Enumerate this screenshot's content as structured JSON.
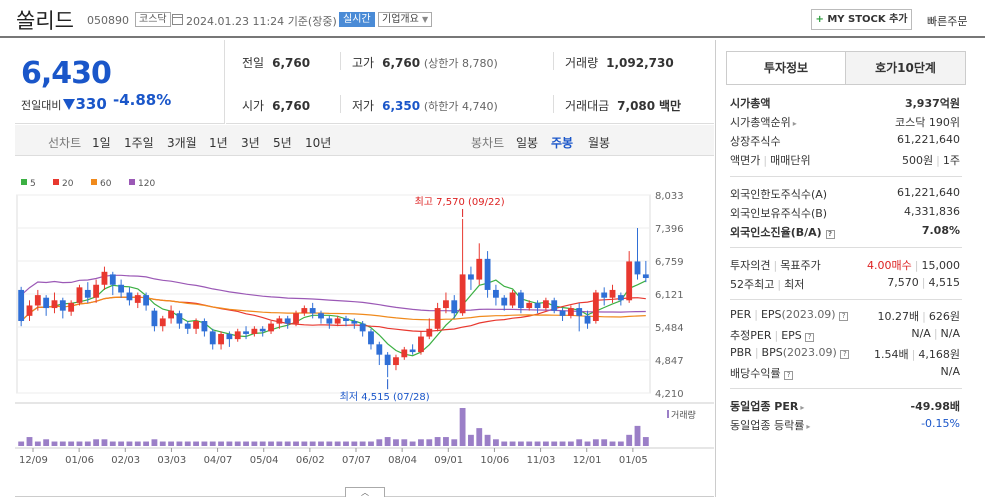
{
  "header": {
    "name": "쏠리드",
    "code": "050890",
    "market": "코스닥",
    "datetime": "2024.01.23 11:24",
    "basis": "기준(장중)",
    "realtime": "실시간",
    "company_info": "기업개요",
    "my_stock": "MY STOCK 추가",
    "quick_order": "빠른주문"
  },
  "quote": {
    "price": "6,430",
    "change_label": "전일대비",
    "change": "330",
    "change_pct": "-4.88%"
  },
  "stats": {
    "prev": {
      "label": "전일",
      "value": "6,760"
    },
    "high": {
      "label": "고가",
      "value": "6,760",
      "sub": "(상한가 8,780)"
    },
    "volume": {
      "label": "거래량",
      "value": "1,092,730"
    },
    "open": {
      "label": "시가",
      "value": "6,760"
    },
    "low": {
      "label": "저가",
      "value": "6,350",
      "sub": "(하한가 4,740)"
    },
    "amount": {
      "label": "거래대금",
      "value": "7,080",
      "unit": "백만"
    }
  },
  "toolbar": {
    "line_label": "선차트",
    "line_periods": [
      "1일",
      "1주일",
      "3개월",
      "1년",
      "3년",
      "5년",
      "10년"
    ],
    "candle_label": "봉차트",
    "candle_periods": [
      "일봉",
      "주봉",
      "월봉"
    ],
    "candle_active": "주봉"
  },
  "right_panel": {
    "tab_invest": "투자정보",
    "tab_order": "호가10단계",
    "rows": {
      "mcap": {
        "k": "시가총액",
        "v": "3,937억원"
      },
      "mcap_rank": {
        "k": "시가총액순위",
        "v": "코스닥 190위"
      },
      "shares": {
        "k": "상장주식수",
        "v": "61,221,640"
      },
      "face": {
        "k": "액면가",
        "k2": "매매단위",
        "v": "500원",
        "v2": "1주"
      },
      "foreign_limit": {
        "k": "외국인한도주식수(A)",
        "v": "61,221,640"
      },
      "foreign_hold": {
        "k": "외국인보유주식수(B)",
        "v": "4,331,836"
      },
      "foreign_rate": {
        "k": "외국인소진율(B/A)",
        "v": "7.08%"
      },
      "opinion": {
        "k": "투자의견",
        "k2": "목표주가",
        "v": "4.00매수",
        "v2": "15,000"
      },
      "week52": {
        "k": "52주최고",
        "k2": "최저",
        "v": "7,570",
        "v2": "4,515"
      },
      "per": {
        "k": "PER",
        "k2": "EPS",
        "k3": "(2023.09)",
        "v": "10.27배",
        "v2": "626원"
      },
      "eper": {
        "k": "추정PER",
        "k2": "EPS",
        "v": "N/A",
        "v2": "N/A"
      },
      "pbr": {
        "k": "PBR",
        "k2": "BPS",
        "k3": "(2023.09)",
        "v": "1.54배",
        "v2": "4,168원"
      },
      "div": {
        "k": "배당수익률",
        "v": "N/A"
      },
      "ind_per": {
        "k": "동일업종 PER",
        "v": "-49.98배"
      },
      "ind_rate": {
        "k": "동일업종 등락률",
        "v": "-0.15%"
      }
    }
  },
  "chart_data": {
    "type": "candlestick",
    "legend": [
      {
        "name": "5",
        "color": "#3cb043"
      },
      {
        "name": "20",
        "color": "#e8382f"
      },
      {
        "name": "60",
        "color": "#f08a1c"
      },
      {
        "name": "120",
        "color": "#9b59b6"
      }
    ],
    "y_ticks": [
      "8,033",
      "7,396",
      "6,759",
      "6,121",
      "5,484",
      "4,847",
      "4,210"
    ],
    "y_range": [
      4210,
      8033
    ],
    "x_ticks": [
      "12/09",
      "01/06",
      "02/03",
      "03/03",
      "04/07",
      "05/04",
      "06/02",
      "07/07",
      "08/04",
      "09/01",
      "10/06",
      "11/03",
      "12/01",
      "01/05"
    ],
    "annotations": {
      "high": "최고 7,570 (09/22)",
      "low": "최저 4,515 (07/28)"
    },
    "volume_label": "거래량",
    "up_color": "#e8382f",
    "down_color": "#2f6fd6",
    "candles": [
      [
        6200,
        5600,
        6260,
        5500
      ],
      [
        5700,
        5900,
        6000,
        5600
      ],
      [
        5900,
        6100,
        6200,
        5800
      ],
      [
        6050,
        5850,
        6100,
        5700
      ],
      [
        5850,
        6000,
        6150,
        5750
      ],
      [
        6000,
        5800,
        6050,
        5650
      ],
      [
        5780,
        5950,
        6000,
        5700
      ],
      [
        5950,
        6250,
        6300,
        5900
      ],
      [
        6200,
        6050,
        6350,
        5950
      ],
      [
        6050,
        6300,
        6400,
        5950
      ],
      [
        6300,
        6550,
        6650,
        6200
      ],
      [
        6500,
        6300,
        6550,
        6100
      ],
      [
        6300,
        6150,
        6400,
        6050
      ],
      [
        6150,
        6000,
        6250,
        5900
      ],
      [
        5950,
        6100,
        6150,
        5850
      ],
      [
        6100,
        5900,
        6150,
        5800
      ],
      [
        5800,
        5500,
        5850,
        5400
      ],
      [
        5500,
        5650,
        5700,
        5400
      ],
      [
        5650,
        5800,
        5900,
        5550
      ],
      [
        5750,
        5550,
        5800,
        5450
      ],
      [
        5550,
        5450,
        5600,
        5350
      ],
      [
        5450,
        5600,
        5650,
        5350
      ],
      [
        5600,
        5400,
        5650,
        5300
      ],
      [
        5400,
        5150,
        5450,
        5050
      ],
      [
        5150,
        5350,
        5400,
        5050
      ],
      [
        5350,
        5250,
        5400,
        5100
      ],
      [
        5250,
        5400,
        5450,
        5200
      ],
      [
        5400,
        5350,
        5500,
        5250
      ],
      [
        5350,
        5450,
        5500,
        5300
      ],
      [
        5450,
        5400,
        5500,
        5300
      ],
      [
        5400,
        5550,
        5600,
        5350
      ],
      [
        5550,
        5650,
        5700,
        5450
      ],
      [
        5650,
        5550,
        5700,
        5450
      ],
      [
        5550,
        5750,
        5800,
        5500
      ],
      [
        5750,
        5850,
        5900,
        5700
      ],
      [
        5850,
        5750,
        5950,
        5650
      ],
      [
        5750,
        5650,
        5800,
        5550
      ],
      [
        5650,
        5550,
        5700,
        5450
      ],
      [
        5550,
        5650,
        5700,
        5500
      ],
      [
        5650,
        5600,
        5700,
        5500
      ],
      [
        5600,
        5550,
        5650,
        5450
      ],
      [
        5550,
        5400,
        5600,
        5300
      ],
      [
        5400,
        5150,
        5450,
        5050
      ],
      [
        5150,
        4950,
        5200,
        4750
      ],
      [
        4950,
        4750,
        5000,
        4515
      ],
      [
        4750,
        4900,
        4950,
        4650
      ],
      [
        4900,
        5050,
        5100,
        4850
      ],
      [
        5050,
        5000,
        5150,
        4950
      ],
      [
        5000,
        5300,
        5400,
        4950
      ],
      [
        5300,
        5450,
        5650,
        5250
      ],
      [
        5450,
        5850,
        5950,
        5400
      ],
      [
        5850,
        6000,
        6150,
        5750
      ],
      [
        6000,
        5750,
        6100,
        5650
      ],
      [
        5750,
        6500,
        7570,
        5700
      ],
      [
        6500,
        6400,
        6650,
        6200
      ],
      [
        6400,
        6800,
        7100,
        6300
      ],
      [
        6800,
        6200,
        6950,
        6050
      ],
      [
        6200,
        6050,
        6300,
        5900
      ],
      [
        6050,
        5900,
        6100,
        5800
      ],
      [
        5900,
        6150,
        6200,
        5850
      ],
      [
        6150,
        5850,
        6200,
        5750
      ],
      [
        5850,
        5950,
        6000,
        5800
      ],
      [
        5950,
        5850,
        6000,
        5750
      ],
      [
        5850,
        6000,
        6050,
        5800
      ],
      [
        6000,
        5800,
        6050,
        5750
      ],
      [
        5800,
        5700,
        5850,
        5600
      ],
      [
        5700,
        5850,
        5900,
        5650
      ],
      [
        5850,
        5700,
        5950,
        5400
      ],
      [
        5700,
        5550,
        5800,
        5450
      ],
      [
        5600,
        6150,
        6200,
        5550
      ],
      [
        6150,
        6050,
        6250,
        5900
      ],
      [
        6050,
        6200,
        6300,
        5950
      ],
      [
        6100,
        6000,
        6150,
        5900
      ],
      [
        6000,
        6750,
        6950,
        5950
      ],
      [
        6750,
        6500,
        7396,
        6400
      ],
      [
        6500,
        6430,
        6760,
        6350
      ]
    ],
    "volume": [
      2,
      4,
      2,
      3,
      2,
      2,
      2,
      2,
      2,
      3,
      3,
      2,
      2,
      2,
      2,
      2,
      3,
      2,
      2,
      2,
      2,
      2,
      2,
      2,
      2,
      2,
      2,
      2,
      2,
      2,
      2,
      2,
      2,
      2,
      2,
      2,
      2,
      2,
      2,
      2,
      2,
      2,
      2,
      3,
      4,
      3,
      3,
      2,
      3,
      3,
      4,
      4,
      3,
      17,
      5,
      8,
      5,
      3,
      2,
      2,
      2,
      2,
      2,
      2,
      2,
      2,
      2,
      3,
      2,
      3,
      3,
      2,
      2,
      5,
      9,
      4
    ]
  }
}
